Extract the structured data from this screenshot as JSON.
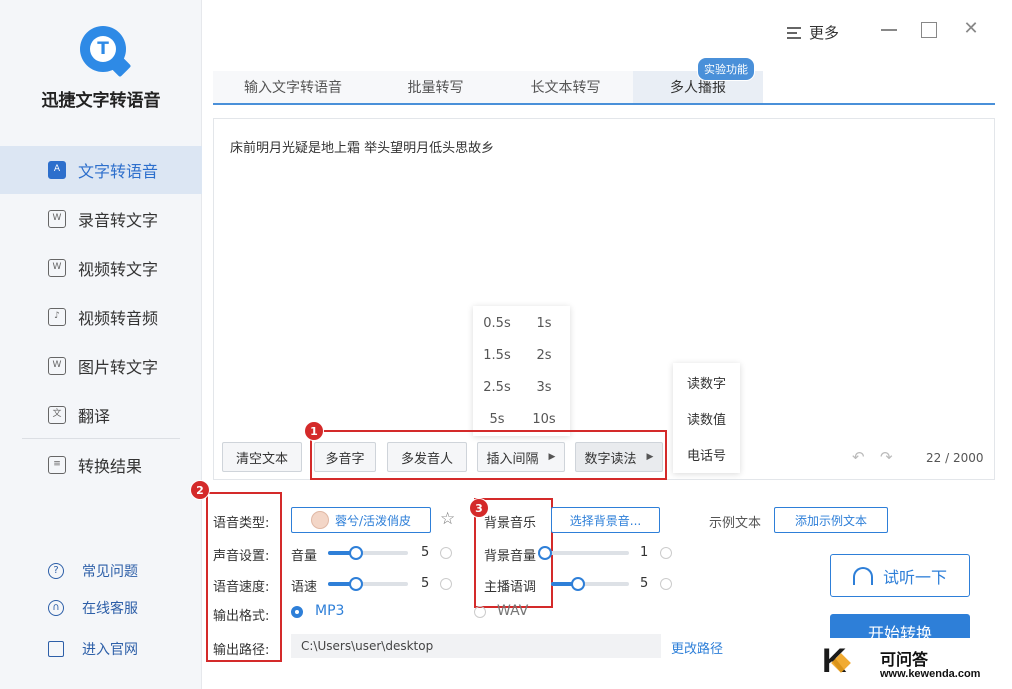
{
  "app": {
    "title": "迅捷文字转语音",
    "logo_letter": "T"
  },
  "sidebar": {
    "items": [
      {
        "label": "文字转语音",
        "icon": "text-to-speech-icon",
        "active": true
      },
      {
        "label": "录音转文字",
        "icon": "audio-to-text-icon"
      },
      {
        "label": "视频转文字",
        "icon": "video-to-text-icon"
      },
      {
        "label": "视频转音频",
        "icon": "video-to-audio-icon"
      },
      {
        "label": "图片转文字",
        "icon": "image-to-text-icon"
      },
      {
        "label": "翻译",
        "icon": "translate-icon"
      },
      {
        "label": "转换结果",
        "icon": "results-icon"
      }
    ],
    "footer": [
      {
        "label": "常见问题",
        "icon": "question-icon"
      },
      {
        "label": "在线客服",
        "icon": "headset-icon"
      },
      {
        "label": "进入官网",
        "icon": "monitor-icon"
      }
    ]
  },
  "topbar": {
    "more_label": "更多"
  },
  "tabs": {
    "items": [
      "输入文字转语音",
      "批量转写",
      "长文本转写",
      "多人播报"
    ],
    "badge": "实验功能"
  },
  "editor": {
    "text": "床前明月光疑是地上霜 举头望明月低头思故乡",
    "counter": "22 / 2000"
  },
  "toolbar": {
    "clear": "清空文本",
    "polyphone": "多音字",
    "multi_speaker": "多发音人",
    "insert_pause": "插入间隔",
    "number_reading": "数字读法"
  },
  "interval_popup": {
    "col1": [
      "0.5s",
      "1.5s",
      "2.5s",
      "5s"
    ],
    "col2": [
      "1s",
      "2s",
      "3s",
      "10s"
    ]
  },
  "number_popup": {
    "items": [
      "读数字",
      "读数值",
      "电话号"
    ]
  },
  "annotations": {
    "n1": "1",
    "n2": "2",
    "n3": "3"
  },
  "settings": {
    "voice_type_label": "语音类型:",
    "voice_name": "蓉兮/活泼俏皮",
    "sound_label": "声音设置:",
    "volume_label": "音量",
    "volume_value": "5",
    "volume_level": 0.35,
    "speed_label": "语音速度:",
    "speed_sub": "语速",
    "speed_value": "5",
    "speed_level": 0.35,
    "format_label": "输出格式:",
    "format_mp3": "MP3",
    "format_wav": "WAV",
    "path_label": "输出路径:",
    "path_value": "C:\\Users\\user\\desktop",
    "change_path": "更改路径"
  },
  "bgm": {
    "label": "背景音乐",
    "select": "选择背景音...",
    "volume_label": "背景音量",
    "volume_value": "1",
    "volume_level": 0.0,
    "tone_label": "主播语调",
    "tone_value": "5",
    "tone_level": 0.35
  },
  "sample": {
    "label": "示例文本",
    "add": "添加示例文本"
  },
  "actions": {
    "listen": "试听一下",
    "start": "开始转换"
  },
  "watermark": {
    "line1": "可问答",
    "line2": "www.kewenda.com",
    "letter": "K"
  },
  "colors": {
    "accent": "#2e7fd8",
    "annotation": "#d42a2a",
    "sidebar_bg": "#f4f6f9"
  }
}
